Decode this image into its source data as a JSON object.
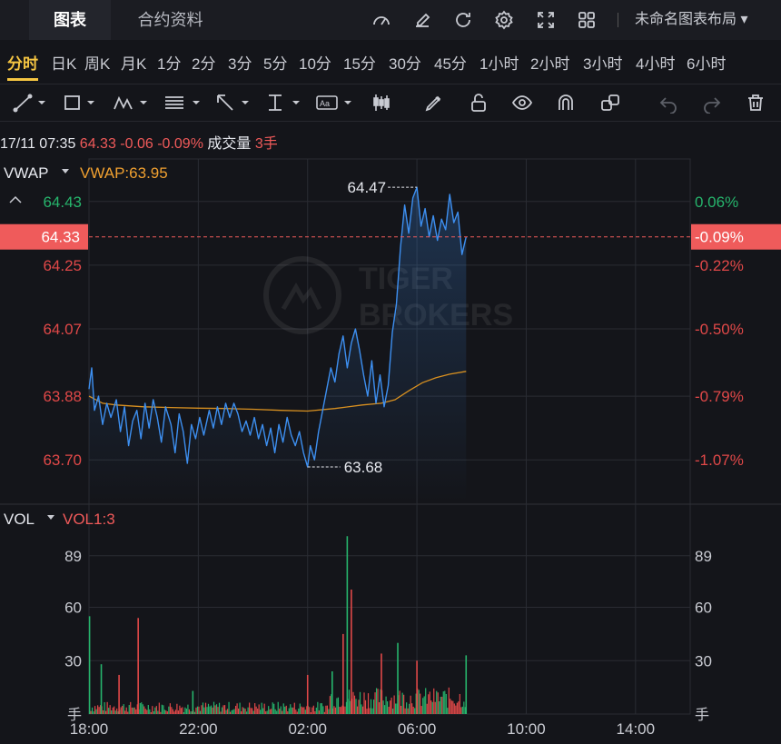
{
  "tabs": [
    {
      "label": "图表",
      "active": true
    },
    {
      "label": "合约资料",
      "active": false
    }
  ],
  "toolbar_icons": [
    "gauge-icon",
    "edit-icon",
    "refresh-icon",
    "settings-icon",
    "fullscreen-icon",
    "grid-layout-icon"
  ],
  "layout_name": "未命名图表布局",
  "periods": [
    "分时",
    "日K",
    "周K",
    "月K",
    "1分",
    "2分",
    "3分",
    "5分",
    "10分",
    "15分",
    "30分",
    "45分",
    "1小时",
    "2小时",
    "3小时",
    "4小时",
    "6小时"
  ],
  "active_period": "分时",
  "draw_tools": [
    "line-tool-icon",
    "rectangle-tool-icon",
    "pattern-tool-icon",
    "fibonacci-tool-icon",
    "arrow-tool-icon",
    "measure-tool-icon",
    "text-tool-icon",
    "candle-tool-icon",
    "pencil-icon",
    "unlock-icon",
    "eye-icon",
    "magnet-icon",
    "clone-icon",
    "undo-icon",
    "redo-icon",
    "trash-icon"
  ],
  "info": {
    "datetime": "17/11 07:35",
    "price": "64.33",
    "change": "-0.06",
    "change_pct": "-0.09%",
    "volume_label": "成交量",
    "volume_value": "3手"
  },
  "indicator": {
    "name": "VWAP",
    "label": "VWAP:63.95"
  },
  "vol_indicator": {
    "name": "VOL",
    "label": "VOL1:3"
  },
  "colors": {
    "line": "#3d8ff0",
    "vwap": "#d89020",
    "up": "#26b46c",
    "down": "#e04848",
    "price_tag": "#ef5b5b",
    "grid": "#2a2c33"
  },
  "chart_data": {
    "type": "line",
    "price_axis": {
      "left_ticks": [
        {
          "value": 64.43,
          "label": "64.43",
          "color": "green"
        },
        {
          "value": 64.25,
          "label": "64.25",
          "color": "red"
        },
        {
          "value": 64.07,
          "label": "64.07",
          "color": "red"
        },
        {
          "value": 63.88,
          "label": "63.88",
          "color": "red"
        },
        {
          "value": 63.7,
          "label": "63.70",
          "color": "red"
        }
      ],
      "right_ticks": [
        {
          "value": 64.43,
          "label": "0.06%",
          "color": "green"
        },
        {
          "value": 64.25,
          "label": "-0.22%",
          "color": "red"
        },
        {
          "value": 64.07,
          "label": "-0.50%",
          "color": "red"
        },
        {
          "value": 63.88,
          "label": "-0.79%",
          "color": "red"
        },
        {
          "value": 63.7,
          "label": "-1.07%",
          "color": "red"
        }
      ],
      "current": {
        "value": 64.33,
        "label": "64.33",
        "pct_label": "-0.09%"
      },
      "ylim": [
        63.58,
        64.55
      ]
    },
    "time_axis": {
      "ticks": [
        {
          "hour": 18,
          "label": "18:00"
        },
        {
          "hour": 22,
          "label": "22:00"
        },
        {
          "hour": 26,
          "label": "02:00"
        },
        {
          "hour": 30,
          "label": "06:00"
        },
        {
          "hour": 34,
          "label": "10:00"
        },
        {
          "hour": 38,
          "label": "14:00"
        }
      ],
      "xlim": [
        18,
        40
      ]
    },
    "max_marker": {
      "hour": 30.0,
      "value": 64.47,
      "label": "64.47"
    },
    "min_marker": {
      "hour": 26.0,
      "value": 63.68,
      "label": "63.68"
    },
    "price_series": {
      "name": "price",
      "points": [
        [
          18.0,
          63.9
        ],
        [
          18.1,
          63.96
        ],
        [
          18.2,
          63.84
        ],
        [
          18.35,
          63.88
        ],
        [
          18.5,
          63.8
        ],
        [
          18.65,
          63.86
        ],
        [
          18.8,
          63.82
        ],
        [
          19.0,
          63.87
        ],
        [
          19.15,
          63.78
        ],
        [
          19.3,
          63.85
        ],
        [
          19.45,
          63.74
        ],
        [
          19.6,
          63.81
        ],
        [
          19.75,
          63.84
        ],
        [
          19.9,
          63.76
        ],
        [
          20.05,
          63.86
        ],
        [
          20.2,
          63.79
        ],
        [
          20.35,
          63.87
        ],
        [
          20.5,
          63.82
        ],
        [
          20.65,
          63.75
        ],
        [
          20.8,
          63.85
        ],
        [
          21.0,
          63.8
        ],
        [
          21.15,
          63.72
        ],
        [
          21.3,
          63.83
        ],
        [
          21.45,
          63.78
        ],
        [
          21.6,
          63.69
        ],
        [
          21.75,
          63.8
        ],
        [
          21.9,
          63.76
        ],
        [
          22.05,
          63.82
        ],
        [
          22.2,
          63.77
        ],
        [
          22.4,
          63.84
        ],
        [
          22.55,
          63.79
        ],
        [
          22.7,
          63.85
        ],
        [
          22.85,
          63.8
        ],
        [
          23.0,
          63.86
        ],
        [
          23.15,
          63.82
        ],
        [
          23.3,
          63.86
        ],
        [
          23.45,
          63.83
        ],
        [
          23.6,
          63.78
        ],
        [
          23.75,
          63.81
        ],
        [
          23.9,
          63.77
        ],
        [
          24.05,
          63.82
        ],
        [
          24.2,
          63.76
        ],
        [
          24.35,
          63.8
        ],
        [
          24.5,
          63.74
        ],
        [
          24.65,
          63.79
        ],
        [
          24.8,
          63.72
        ],
        [
          24.95,
          63.8
        ],
        [
          25.1,
          63.75
        ],
        [
          25.25,
          63.82
        ],
        [
          25.4,
          63.77
        ],
        [
          25.55,
          63.74
        ],
        [
          25.7,
          63.78
        ],
        [
          25.85,
          63.72
        ],
        [
          26.0,
          63.68
        ],
        [
          26.1,
          63.74
        ],
        [
          26.25,
          63.7
        ],
        [
          26.4,
          63.78
        ],
        [
          26.55,
          63.84
        ],
        [
          26.7,
          63.9
        ],
        [
          26.85,
          63.96
        ],
        [
          27.0,
          63.92
        ],
        [
          27.15,
          64.0
        ],
        [
          27.3,
          64.05
        ],
        [
          27.45,
          63.96
        ],
        [
          27.6,
          64.03
        ],
        [
          27.75,
          64.07
        ],
        [
          27.9,
          64.01
        ],
        [
          28.05,
          63.94
        ],
        [
          28.2,
          63.88
        ],
        [
          28.35,
          63.98
        ],
        [
          28.5,
          63.86
        ],
        [
          28.65,
          63.94
        ],
        [
          28.8,
          63.85
        ],
        [
          28.95,
          63.91
        ],
        [
          29.1,
          64.06
        ],
        [
          29.25,
          64.14
        ],
        [
          29.4,
          64.3
        ],
        [
          29.55,
          64.42
        ],
        [
          29.7,
          64.34
        ],
        [
          29.85,
          64.44
        ],
        [
          30.0,
          64.47
        ],
        [
          30.15,
          64.36
        ],
        [
          30.3,
          64.41
        ],
        [
          30.45,
          64.33
        ],
        [
          30.6,
          64.39
        ],
        [
          30.75,
          64.32
        ],
        [
          30.9,
          64.38
        ],
        [
          31.05,
          64.35
        ],
        [
          31.2,
          64.45
        ],
        [
          31.35,
          64.37
        ],
        [
          31.5,
          64.4
        ],
        [
          31.65,
          64.28
        ],
        [
          31.8,
          64.33
        ]
      ]
    },
    "vwap_series": {
      "name": "VWAP",
      "points": [
        [
          18.0,
          63.88
        ],
        [
          18.5,
          63.86
        ],
        [
          19.0,
          63.855
        ],
        [
          20.0,
          63.85
        ],
        [
          21.0,
          63.848
        ],
        [
          22.0,
          63.846
        ],
        [
          23.0,
          63.845
        ],
        [
          24.0,
          63.843
        ],
        [
          25.0,
          63.84
        ],
        [
          26.0,
          63.838
        ],
        [
          27.0,
          63.845
        ],
        [
          28.0,
          63.855
        ],
        [
          28.7,
          63.86
        ],
        [
          29.2,
          63.87
        ],
        [
          29.7,
          63.895
        ],
        [
          30.2,
          63.918
        ],
        [
          30.7,
          63.932
        ],
        [
          31.2,
          63.942
        ],
        [
          31.8,
          63.95
        ]
      ]
    },
    "volume_axis": {
      "ticks": [
        {
          "value": 89,
          "label": "89"
        },
        {
          "value": 60,
          "label": "60"
        },
        {
          "value": 30,
          "label": "30"
        }
      ],
      "unit_label": "手",
      "ylim": [
        0,
        118
      ]
    },
    "volume_spikes": [
      {
        "hour": 18.02,
        "value": 55,
        "dir": "up"
      },
      {
        "hour": 18.45,
        "value": 28,
        "dir": "up"
      },
      {
        "hour": 19.1,
        "value": 22,
        "dir": "down"
      },
      {
        "hour": 19.8,
        "value": 54,
        "dir": "down"
      },
      {
        "hour": 21.8,
        "value": 13,
        "dir": "up"
      },
      {
        "hour": 26.0,
        "value": 22,
        "dir": "down"
      },
      {
        "hour": 26.9,
        "value": 24,
        "dir": "up"
      },
      {
        "hour": 27.3,
        "value": 45,
        "dir": "down"
      },
      {
        "hour": 27.45,
        "value": 100,
        "dir": "up"
      },
      {
        "hour": 27.6,
        "value": 70,
        "dir": "down"
      },
      {
        "hour": 28.7,
        "value": 34,
        "dir": "down"
      },
      {
        "hour": 29.3,
        "value": 40,
        "dir": "up"
      },
      {
        "hour": 30.0,
        "value": 30,
        "dir": "down"
      },
      {
        "hour": 31.8,
        "value": 33,
        "dir": "up"
      }
    ]
  }
}
